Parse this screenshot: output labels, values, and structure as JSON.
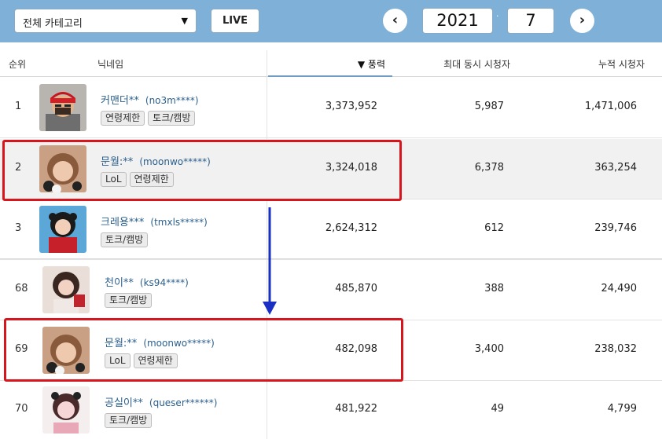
{
  "filter": {
    "category_label": "전체 카테고리",
    "live_label": "LIVE",
    "year": "2021",
    "month": "7",
    "separator": "·"
  },
  "table": {
    "headers": {
      "rank": "순위",
      "nickname": "닉네임",
      "balloon": "▼ 풍력",
      "max_viewers": "최대 동시 시청자",
      "total_viewers": "누적 시청자"
    },
    "rows": [
      {
        "rank": "1",
        "nick": "커맨더**",
        "uid": "(no3m****)",
        "tags": [
          "연령제한",
          "토크/캠방"
        ],
        "balloon": "3,373,952",
        "max": "5,987",
        "total": "1,471,006"
      },
      {
        "rank": "2",
        "nick": "문월:**",
        "uid": "(moonwo*****)",
        "tags": [
          "LoL",
          "연령제한"
        ],
        "balloon": "3,324,018",
        "max": "6,378",
        "total": "363,254"
      },
      {
        "rank": "3",
        "nick": "크레용***",
        "uid": "(tmxls*****)",
        "tags": [
          "토크/캠방"
        ],
        "balloon": "2,624,312",
        "max": "612",
        "total": "239,746"
      },
      {
        "rank": "68",
        "nick": "천이**",
        "uid": "(ks94****)",
        "tags": [
          "토크/캠방"
        ],
        "balloon": "485,870",
        "max": "388",
        "total": "24,490"
      },
      {
        "rank": "69",
        "nick": "문월:**",
        "uid": "(moonwo*****)",
        "tags": [
          "LoL",
          "연령제한"
        ],
        "balloon": "482,098",
        "max": "3,400",
        "total": "238,032"
      },
      {
        "rank": "70",
        "nick": "공실이**",
        "uid": "(queser******)",
        "tags": [
          "토크/캠방"
        ],
        "balloon": "481,922",
        "max": "49",
        "total": "4,799"
      }
    ]
  },
  "colors": {
    "topbar": "#7fb0d8",
    "highlight_box": "#d8141c",
    "arrow": "#1a2fc4",
    "nick_text": "#2b5f8c"
  }
}
